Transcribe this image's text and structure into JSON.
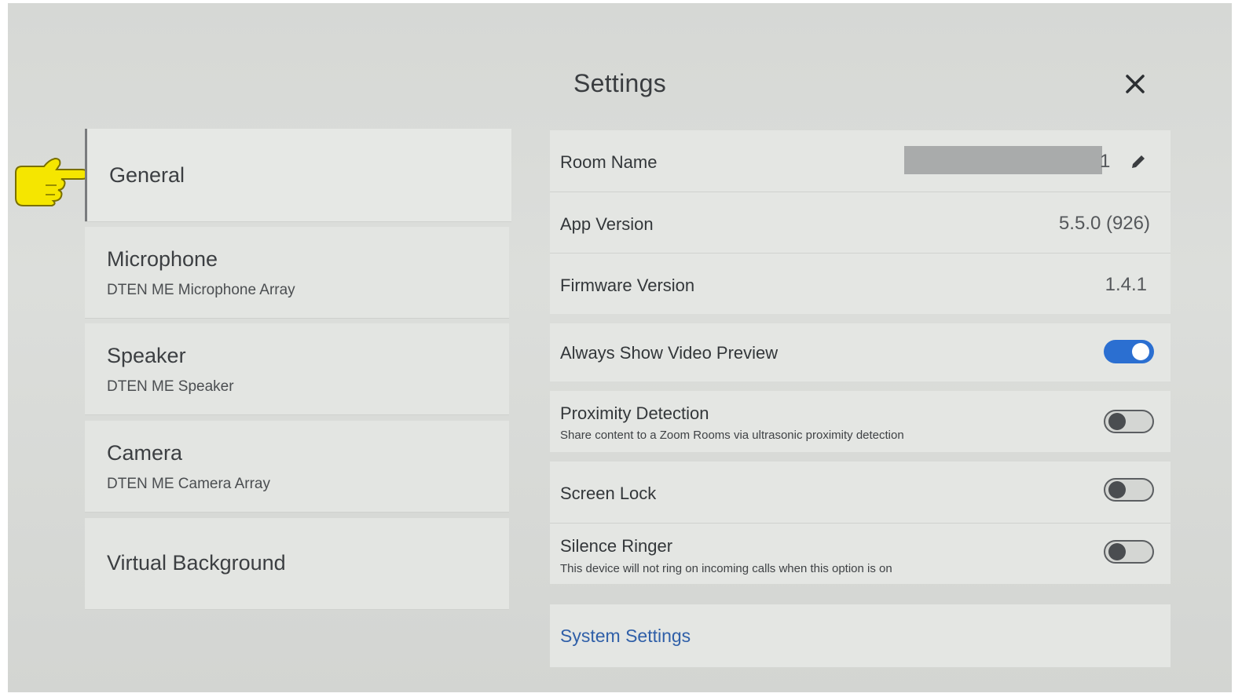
{
  "header": {
    "title": "Settings"
  },
  "nav": {
    "items": [
      {
        "label": "General",
        "sub": ""
      },
      {
        "label": "Microphone",
        "sub": "DTEN ME Microphone Array"
      },
      {
        "label": "Speaker",
        "sub": "DTEN ME Speaker"
      },
      {
        "label": "Camera",
        "sub": "DTEN ME Camera Array"
      },
      {
        "label": "Virtual Background",
        "sub": ""
      }
    ]
  },
  "general": {
    "room_name": {
      "label": "Room Name",
      "value": "1"
    },
    "app_version": {
      "label": "App Version",
      "value": "5.5.0 (926)"
    },
    "firmware_version": {
      "label": "Firmware Version",
      "value": "1.4.1"
    },
    "always_show_video_preview": {
      "label": "Always Show Video Preview",
      "on": true
    },
    "proximity_detection": {
      "label": "Proximity Detection",
      "description": "Share content to a Zoom Rooms via ultrasonic proximity detection",
      "on": false
    },
    "screen_lock": {
      "label": "Screen Lock",
      "on": false
    },
    "silence_ringer": {
      "label": "Silence Ringer",
      "description": "This device will not ring on incoming calls when this option is on",
      "on": false
    },
    "system_settings_link": "System Settings"
  },
  "colors": {
    "toggle_on": "#2b6fd1",
    "link": "#2f5fa8",
    "pointer": "#f5e600"
  },
  "icons": [
    "close-icon",
    "pencil-icon",
    "pointing-hand-icon"
  ]
}
